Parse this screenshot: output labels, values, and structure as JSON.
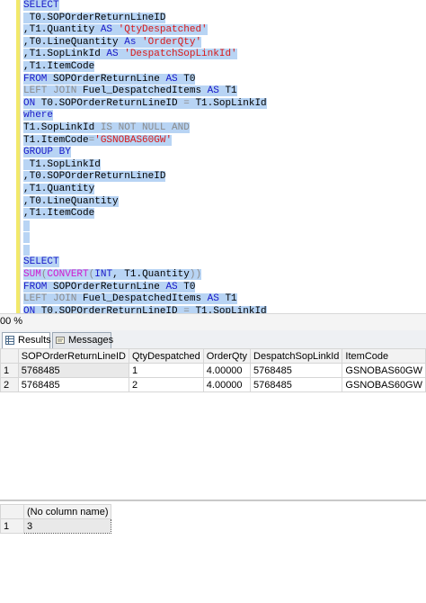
{
  "editor": {
    "lines": [
      [
        {
          "t": "SELECT",
          "c": "kw"
        }
      ],
      [
        {
          "t": " T0.SOPOrderReturnLineID",
          "c": "tx"
        }
      ],
      [
        {
          "t": ",T1.Quantity ",
          "c": "tx"
        },
        {
          "t": "AS",
          "c": "kw"
        },
        {
          "t": " ",
          "c": "tx"
        },
        {
          "t": "'QtyDespatched'",
          "c": "str"
        }
      ],
      [
        {
          "t": ",T0.LineQuantity ",
          "c": "tx"
        },
        {
          "t": "As",
          "c": "kw"
        },
        {
          "t": " ",
          "c": "tx"
        },
        {
          "t": "'OrderQty'",
          "c": "str"
        }
      ],
      [
        {
          "t": ",T1.SopLinkId ",
          "c": "tx"
        },
        {
          "t": "AS",
          "c": "kw"
        },
        {
          "t": " ",
          "c": "tx"
        },
        {
          "t": "'DespatchSopLinkId'",
          "c": "str"
        }
      ],
      [
        {
          "t": ",T1.ItemCode",
          "c": "tx"
        }
      ],
      [
        {
          "t": "FROM",
          "c": "kw"
        },
        {
          "t": " SOPOrderReturnLine ",
          "c": "tx"
        },
        {
          "t": "AS",
          "c": "kw"
        },
        {
          "t": " T0",
          "c": "tx"
        }
      ],
      [
        {
          "t": "LEFT JOIN",
          "c": "gr"
        },
        {
          "t": " Fuel_DespatchedItems ",
          "c": "tx"
        },
        {
          "t": "AS",
          "c": "kw"
        },
        {
          "t": " T1",
          "c": "tx"
        }
      ],
      [
        {
          "t": "ON",
          "c": "kw"
        },
        {
          "t": " T0.SOPOrderReturnLineID ",
          "c": "tx"
        },
        {
          "t": "=",
          "c": "gr"
        },
        {
          "t": " T1.SopLinkId",
          "c": "tx"
        }
      ],
      [
        {
          "t": "where",
          "c": "kw"
        }
      ],
      [
        {
          "t": "T1.SopLinkId ",
          "c": "tx"
        },
        {
          "t": "IS NOT NULL AND",
          "c": "gr"
        }
      ],
      [
        {
          "t": "T1.ItemCode",
          "c": "tx"
        },
        {
          "t": "=",
          "c": "gr"
        },
        {
          "t": "'GSNOBAS60GW'",
          "c": "str"
        }
      ],
      [
        {
          "t": "GROUP BY",
          "c": "kw"
        }
      ],
      [
        {
          "t": " T1.SopLinkId",
          "c": "tx"
        }
      ],
      [
        {
          "t": ",T0.SOPOrderReturnLineID",
          "c": "tx"
        }
      ],
      [
        {
          "t": ",T1.Quantity",
          "c": "tx"
        }
      ],
      [
        {
          "t": ",T0.LineQuantity",
          "c": "tx"
        }
      ],
      [
        {
          "t": ",T1.ItemCode",
          "c": "tx"
        }
      ],
      [
        {
          "t": " ",
          "c": "tx"
        }
      ],
      [
        {
          "t": " ",
          "c": "tx"
        }
      ],
      [
        {
          "t": " ",
          "c": "tx"
        }
      ],
      [
        {
          "t": "SELECT",
          "c": "kw"
        }
      ],
      [
        {
          "t": "SUM",
          "c": "fn"
        },
        {
          "t": "(",
          "c": "gr"
        },
        {
          "t": "CONVERT",
          "c": "fn"
        },
        {
          "t": "(",
          "c": "gr"
        },
        {
          "t": "INT",
          "c": "kw"
        },
        {
          "t": ", T1.Quantity",
          "c": "tx"
        },
        {
          "t": "))",
          "c": "gr"
        }
      ],
      [
        {
          "t": "FROM",
          "c": "kw"
        },
        {
          "t": " SOPOrderReturnLine ",
          "c": "tx"
        },
        {
          "t": "AS",
          "c": "kw"
        },
        {
          "t": " T0",
          "c": "tx"
        }
      ],
      [
        {
          "t": "LEFT JOIN",
          "c": "gr"
        },
        {
          "t": " Fuel_DespatchedItems ",
          "c": "tx"
        },
        {
          "t": "AS",
          "c": "kw"
        },
        {
          "t": " T1",
          "c": "tx"
        }
      ],
      [
        {
          "t": "ON",
          "c": "kw"
        },
        {
          "t": " T0.SOPOrderReturnLineID ",
          "c": "tx"
        },
        {
          "t": "=",
          "c": "gr"
        },
        {
          "t": " T1.SopLinkId",
          "c": "tx"
        }
      ]
    ]
  },
  "zoom": {
    "label": "00 %"
  },
  "tabs": {
    "results_label": "Results",
    "messages_label": "Messages",
    "results_icon": "grid-icon",
    "messages_icon": "message-icon"
  },
  "grid1": {
    "headers": [
      "SOPOrderReturnLineID",
      "QtyDespatched",
      "OrderQty",
      "DespatchSopLinkId",
      "ItemCode"
    ],
    "rows": [
      {
        "num": "1",
        "cells": [
          "5768485",
          "1",
          "4.00000",
          "5768485",
          "GSNOBAS60GW"
        ]
      },
      {
        "num": "2",
        "cells": [
          "5768485",
          "2",
          "4.00000",
          "5768485",
          "GSNOBAS60GW"
        ]
      }
    ]
  },
  "grid2": {
    "headers": [
      "(No column name)"
    ],
    "rows": [
      {
        "num": "1",
        "cells": [
          "3"
        ]
      }
    ]
  }
}
